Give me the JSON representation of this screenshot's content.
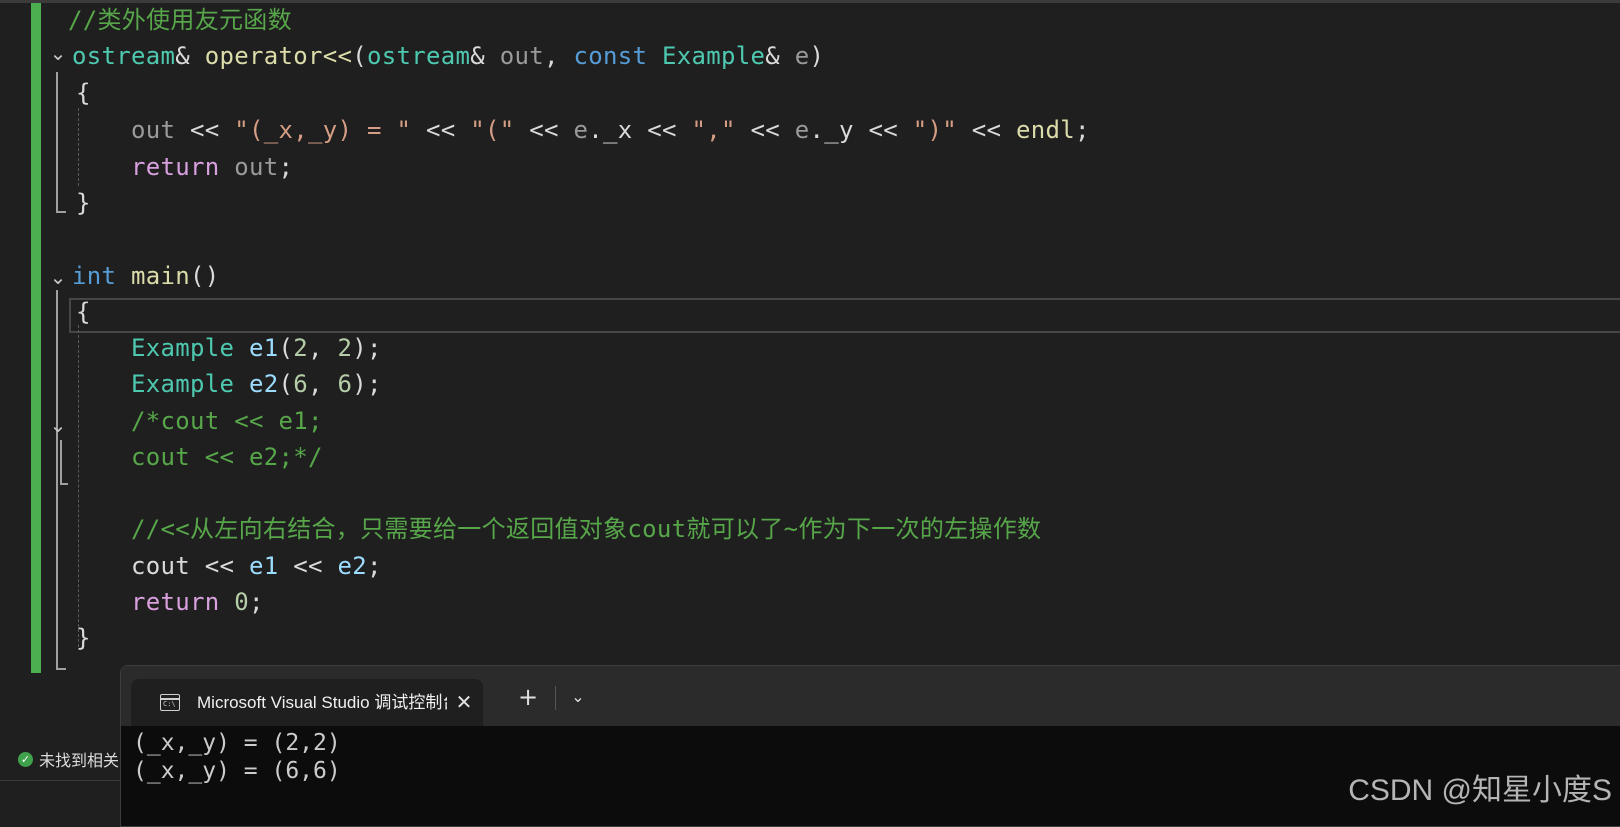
{
  "editor": {
    "lines": [
      {
        "parts": [
          {
            "t": "//类外使用友元函数",
            "c": "comment"
          }
        ]
      },
      {
        "parts": [
          {
            "t": "ostream",
            "c": "type"
          },
          {
            "t": "& ",
            "c": "plain"
          },
          {
            "t": "operator<<",
            "c": "fn"
          },
          {
            "t": "(",
            "c": "plain"
          },
          {
            "t": "ostream",
            "c": "type"
          },
          {
            "t": "& ",
            "c": "plain"
          },
          {
            "t": "out",
            "c": "param"
          },
          {
            "t": ", ",
            "c": "plain"
          },
          {
            "t": "const ",
            "c": "kw"
          },
          {
            "t": "Example",
            "c": "type"
          },
          {
            "t": "& ",
            "c": "plain"
          },
          {
            "t": "e",
            "c": "param"
          },
          {
            "t": ")",
            "c": "plain"
          }
        ]
      },
      {
        "parts": [
          {
            "t": "{",
            "c": "plain"
          }
        ]
      },
      {
        "parts": [
          {
            "t": "    ",
            "c": "plain"
          },
          {
            "t": "out",
            "c": "param"
          },
          {
            "t": " << ",
            "c": "plain"
          },
          {
            "t": "\"(_x,_y) = \"",
            "c": "str"
          },
          {
            "t": " << ",
            "c": "plain"
          },
          {
            "t": "\"(\"",
            "c": "str"
          },
          {
            "t": " << ",
            "c": "plain"
          },
          {
            "t": "e",
            "c": "param"
          },
          {
            "t": ".",
            "c": "plain"
          },
          {
            "t": "_x",
            "c": "member"
          },
          {
            "t": " << ",
            "c": "plain"
          },
          {
            "t": "\",\"",
            "c": "str"
          },
          {
            "t": " << ",
            "c": "plain"
          },
          {
            "t": "e",
            "c": "param"
          },
          {
            "t": ".",
            "c": "plain"
          },
          {
            "t": "_y",
            "c": "member"
          },
          {
            "t": " << ",
            "c": "plain"
          },
          {
            "t": "\")\"",
            "c": "str"
          },
          {
            "t": " << ",
            "c": "plain"
          },
          {
            "t": "endl",
            "c": "fn"
          },
          {
            "t": ";",
            "c": "plain"
          }
        ]
      },
      {
        "parts": [
          {
            "t": "    ",
            "c": "plain"
          },
          {
            "t": "return ",
            "c": "ctrl"
          },
          {
            "t": "out",
            "c": "param"
          },
          {
            "t": ";",
            "c": "plain"
          }
        ]
      },
      {
        "parts": [
          {
            "t": "}",
            "c": "plain"
          }
        ]
      },
      {
        "parts": []
      },
      {
        "parts": [
          {
            "t": "int ",
            "c": "kw"
          },
          {
            "t": "main",
            "c": "fn"
          },
          {
            "t": "()",
            "c": "plain"
          }
        ]
      },
      {
        "parts": [
          {
            "t": "{",
            "c": "plain"
          }
        ]
      },
      {
        "parts": [
          {
            "t": "    ",
            "c": "plain"
          },
          {
            "t": "Example ",
            "c": "type"
          },
          {
            "t": "e1",
            "c": "var"
          },
          {
            "t": "(",
            "c": "plain"
          },
          {
            "t": "2",
            "c": "num"
          },
          {
            "t": ", ",
            "c": "plain"
          },
          {
            "t": "2",
            "c": "num"
          },
          {
            "t": ");",
            "c": "plain"
          }
        ]
      },
      {
        "parts": [
          {
            "t": "    ",
            "c": "plain"
          },
          {
            "t": "Example ",
            "c": "type"
          },
          {
            "t": "e2",
            "c": "var"
          },
          {
            "t": "(",
            "c": "plain"
          },
          {
            "t": "6",
            "c": "num"
          },
          {
            "t": ", ",
            "c": "plain"
          },
          {
            "t": "6",
            "c": "num"
          },
          {
            "t": ");",
            "c": "plain"
          }
        ]
      },
      {
        "parts": [
          {
            "t": "    ",
            "c": "plain"
          },
          {
            "t": "/*cout << e1;",
            "c": "comment"
          }
        ]
      },
      {
        "parts": [
          {
            "t": "    ",
            "c": "plain"
          },
          {
            "t": "cout << e2;*/",
            "c": "comment"
          }
        ]
      },
      {
        "parts": []
      },
      {
        "parts": [
          {
            "t": "    ",
            "c": "plain"
          },
          {
            "t": "//<<从左向右结合，只需要给一个返回值对象cout就可以了~作为下一次的左操作数",
            "c": "comment"
          }
        ]
      },
      {
        "parts": [
          {
            "t": "    ",
            "c": "plain"
          },
          {
            "t": "cout",
            "c": "plain"
          },
          {
            "t": " << ",
            "c": "plain"
          },
          {
            "t": "e1",
            "c": "var"
          },
          {
            "t": " << ",
            "c": "plain"
          },
          {
            "t": "e2",
            "c": "var"
          },
          {
            "t": ";",
            "c": "plain"
          }
        ]
      },
      {
        "parts": [
          {
            "t": "    ",
            "c": "plain"
          },
          {
            "t": "return ",
            "c": "ctrl"
          },
          {
            "t": "0",
            "c": "num"
          },
          {
            "t": ";",
            "c": "plain"
          }
        ]
      },
      {
        "parts": [
          {
            "t": "}",
            "c": "plain"
          }
        ]
      }
    ],
    "fold_glyph": "⌄"
  },
  "status": {
    "text": "未找到相关问题",
    "icon": "check-circle-icon"
  },
  "terminal": {
    "tab_title": "Microsoft Visual Studio 调试控制台",
    "close_glyph": "✕",
    "add_glyph": "+",
    "dropdown_glyph": "⌄",
    "icon_label": "C:\\",
    "output": [
      "(_x,_y) = (2,2)",
      "(_x,_y) = (6,6)"
    ]
  },
  "watermark": "CSDN @知星小度S"
}
